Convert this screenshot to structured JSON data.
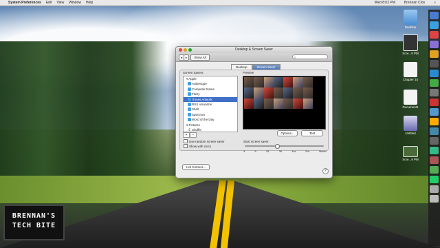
{
  "menubar": {
    "app": "System Preferences",
    "items": [
      "Edit",
      "View",
      "Window",
      "Help"
    ],
    "clock": "Wed 8:02 PM",
    "user": "Brennan Clos"
  },
  "window": {
    "title": "Desktop & Screen Saver",
    "show_all": "Show All",
    "tabs": [
      "Desktop",
      "Screen Saver"
    ],
    "active_tab": "Screen Saver",
    "screen_savers_label": "Screen Savers",
    "list": [
      {
        "label": "Apple",
        "group": true
      },
      {
        "label": "Arabesque"
      },
      {
        "label": "Computer Name"
      },
      {
        "label": "Flurry"
      },
      {
        "label": "iTunes Artwork",
        "selected": true
      },
      {
        "label": "RSS Visualizer"
      },
      {
        "label": "Shell"
      },
      {
        "label": "Spectrum"
      },
      {
        "label": "Word of the Day"
      },
      {
        "label": "Pictures",
        "group": true
      },
      {
        "label": "Shuffle"
      }
    ],
    "preview_label": "Preview",
    "options_button": "Options...",
    "test_button": "Test",
    "use_random_label": "Use random screen saver",
    "show_clock_label": "Show with clock",
    "start_label": "Start screen saver:",
    "start_ticks": [
      "3",
      "5",
      "15",
      "30",
      "1hr",
      "2hr",
      "Never"
    ],
    "hot_corners_button": "Hot Corners..."
  },
  "desktop_icons": [
    {
      "label": "Desktop"
    },
    {
      "label": "Scre...9 PM"
    },
    {
      "label": "Chapter 15"
    },
    {
      "label": "Document1"
    },
    {
      "label": "Untitled"
    },
    {
      "label": "Scre...9 PM"
    }
  ],
  "brand": {
    "line1": "BRENNAN'S",
    "line2": "TECH BITE"
  },
  "colors": {
    "selection": "#3f6fc7",
    "road_line": "#f2c200"
  }
}
